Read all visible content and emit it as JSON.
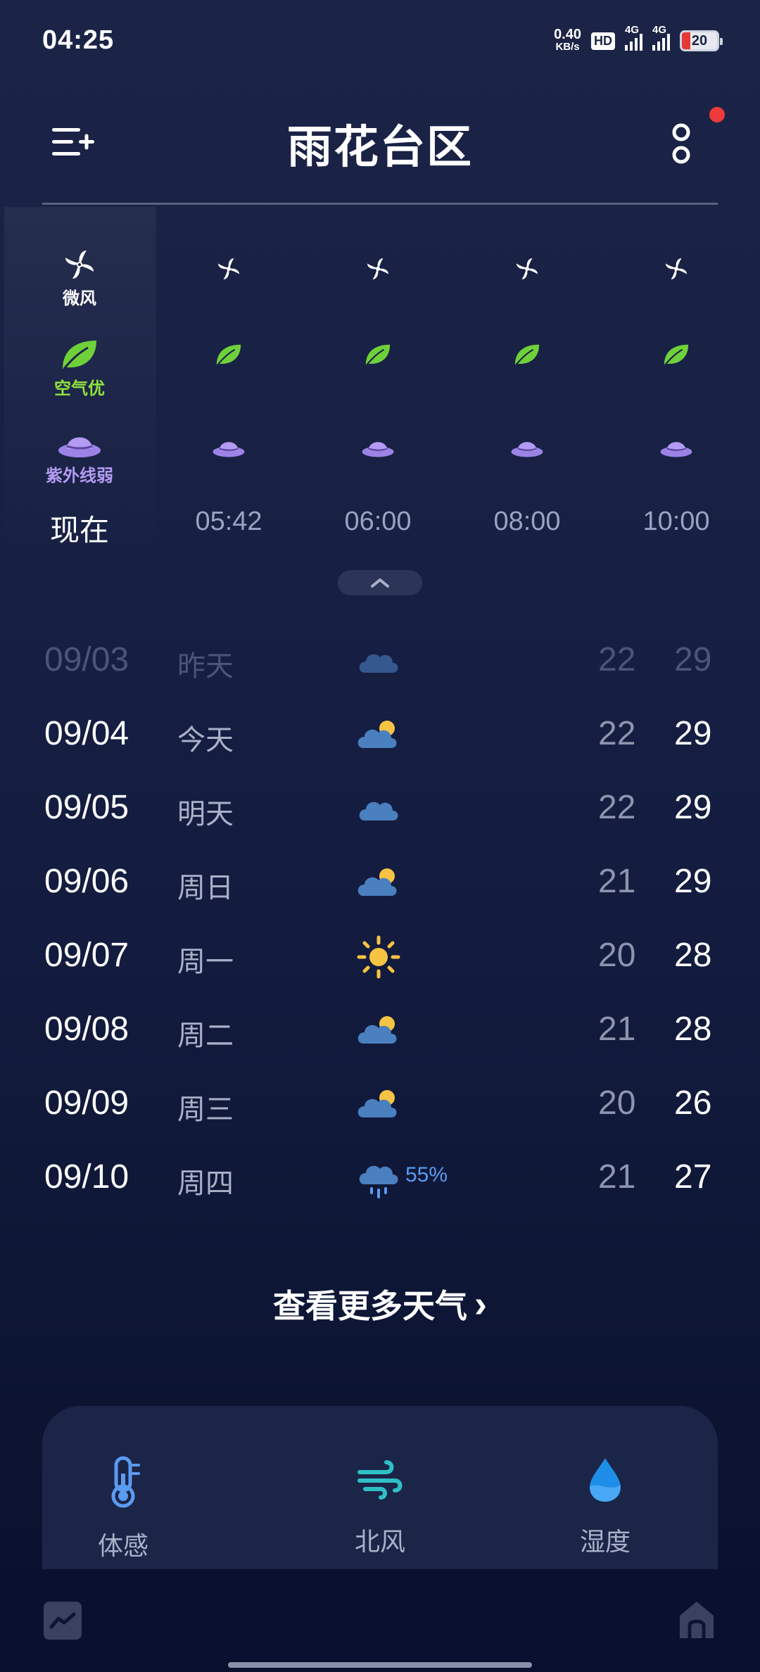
{
  "status_bar": {
    "time": "04:25",
    "net_speed_value": "0.40",
    "net_speed_unit": "KB/s",
    "hd_label": "HD",
    "signal_1_label": "4G",
    "signal_2_label": "4G",
    "battery_level": "20"
  },
  "header": {
    "title": "雨花台区",
    "has_notification": true
  },
  "hourly": [
    {
      "time": "现在",
      "wind_label": "微风",
      "air_label": "空气优",
      "uv_label": "紫外线弱",
      "is_now": true
    },
    {
      "time": "05:42",
      "wind_label": "",
      "air_label": "",
      "uv_label": "",
      "is_now": false
    },
    {
      "time": "06:00",
      "wind_label": "",
      "air_label": "",
      "uv_label": "",
      "is_now": false
    },
    {
      "time": "08:00",
      "wind_label": "",
      "air_label": "",
      "uv_label": "",
      "is_now": false
    },
    {
      "time": "10:00",
      "wind_label": "",
      "air_label": "",
      "uv_label": "",
      "is_now": false
    }
  ],
  "daily": [
    {
      "date": "09/03",
      "day": "昨天",
      "icon": "cloudy-icon",
      "pop": "",
      "low": "22",
      "high": "29",
      "past": true
    },
    {
      "date": "09/04",
      "day": "今天",
      "icon": "partly-cloudy-icon",
      "pop": "",
      "low": "22",
      "high": "29",
      "past": false
    },
    {
      "date": "09/05",
      "day": "明天",
      "icon": "cloudy-icon",
      "pop": "",
      "low": "22",
      "high": "29",
      "past": false
    },
    {
      "date": "09/06",
      "day": "周日",
      "icon": "partly-cloudy-icon",
      "pop": "",
      "low": "21",
      "high": "29",
      "past": false
    },
    {
      "date": "09/07",
      "day": "周一",
      "icon": "sunny-icon",
      "pop": "",
      "low": "20",
      "high": "28",
      "past": false
    },
    {
      "date": "09/08",
      "day": "周二",
      "icon": "partly-cloudy-icon",
      "pop": "",
      "low": "21",
      "high": "28",
      "past": false
    },
    {
      "date": "09/09",
      "day": "周三",
      "icon": "partly-cloudy-icon",
      "pop": "",
      "low": "20",
      "high": "26",
      "past": false
    },
    {
      "date": "09/10",
      "day": "周四",
      "icon": "rain-icon",
      "pop": "55%",
      "low": "21",
      "high": "27",
      "past": false
    }
  ],
  "more_weather": {
    "label": "查看更多天气",
    "arrow": "›"
  },
  "details": [
    {
      "label": "体感",
      "icon": "thermometer-icon"
    },
    {
      "label": "北风",
      "icon": "wind-icon"
    },
    {
      "label": "湿度",
      "icon": "humidity-drop-icon"
    }
  ],
  "colors": {
    "accent_green": "#8fe33c",
    "accent_purple": "#b39af2",
    "cloud_blue": "#4a7fc0",
    "sun_yellow": "#f6c343",
    "rain_blue": "#5a9bf0"
  }
}
